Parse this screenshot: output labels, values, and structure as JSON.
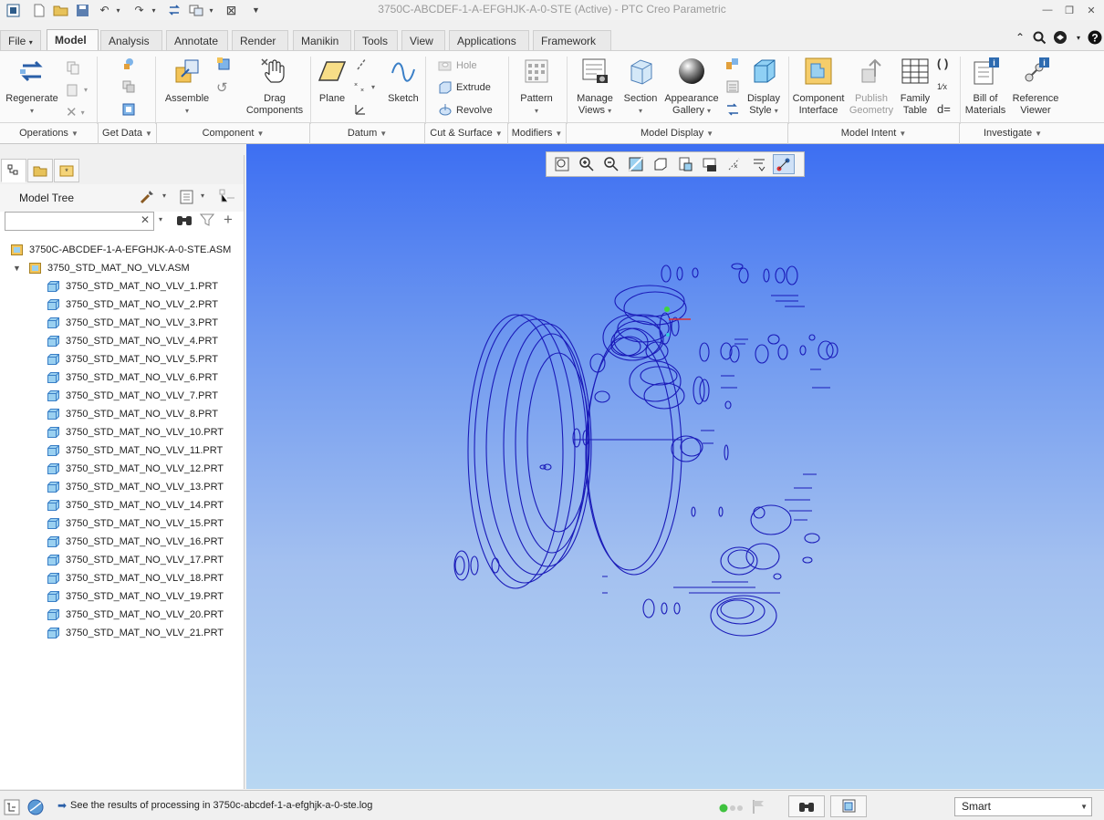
{
  "window": {
    "title": "3750C-ABCDEF-1-A-EFGHJK-A-0-STE (Active) - PTC Creo Parametric"
  },
  "tabs": [
    {
      "label": "File",
      "has_menu": true
    },
    {
      "label": "Model",
      "active": true
    },
    {
      "label": "Analysis"
    },
    {
      "label": "Annotate"
    },
    {
      "label": "Render"
    },
    {
      "label": "Manikin"
    },
    {
      "label": "Tools"
    },
    {
      "label": "View"
    },
    {
      "label": "Applications"
    },
    {
      "label": "Framework"
    }
  ],
  "ribbon": {
    "regenerate": "Regenerate",
    "assemble": "Assemble",
    "drag_line1": "Drag",
    "drag_line2": "Components",
    "plane": "Plane",
    "sketch": "Sketch",
    "hole": "Hole",
    "extrude": "Extrude",
    "revolve": "Revolve",
    "pattern": "Pattern",
    "manage_line1": "Manage",
    "manage_line2": "Views",
    "section": "Section",
    "appearance_line1": "Appearance",
    "appearance_line2": "Gallery",
    "display_line1": "Display",
    "display_line2": "Style",
    "compint_line1": "Component",
    "compint_line2": "Interface",
    "publish_line1": "Publish",
    "publish_line2": "Geometry",
    "family_line1": "Family",
    "family_line2": "Table",
    "bom_line1": "Bill of",
    "bom_line2": "Materials",
    "ref_line1": "Reference",
    "ref_line2": "Viewer"
  },
  "groups": [
    {
      "label": "Operations"
    },
    {
      "label": "Get Data"
    },
    {
      "label": "Component"
    },
    {
      "label": "Datum"
    },
    {
      "label": "Cut & Surface"
    },
    {
      "label": "Modifiers"
    },
    {
      "label": "Model Display"
    },
    {
      "label": "Model Intent"
    },
    {
      "label": "Investigate"
    }
  ],
  "model_tree": {
    "header": "Model Tree",
    "search_value": "",
    "root": "3750C-ABCDEF-1-A-EFGHJK-A-0-STE.ASM",
    "sub": "3750_STD_MAT_NO_VLV.ASM",
    "parts": [
      "3750_STD_MAT_NO_VLV_1.PRT",
      "3750_STD_MAT_NO_VLV_2.PRT",
      "3750_STD_MAT_NO_VLV_3.PRT",
      "3750_STD_MAT_NO_VLV_4.PRT",
      "3750_STD_MAT_NO_VLV_5.PRT",
      "3750_STD_MAT_NO_VLV_6.PRT",
      "3750_STD_MAT_NO_VLV_7.PRT",
      "3750_STD_MAT_NO_VLV_8.PRT",
      "3750_STD_MAT_NO_VLV_10.PRT",
      "3750_STD_MAT_NO_VLV_11.PRT",
      "3750_STD_MAT_NO_VLV_12.PRT",
      "3750_STD_MAT_NO_VLV_13.PRT",
      "3750_STD_MAT_NO_VLV_14.PRT",
      "3750_STD_MAT_NO_VLV_15.PRT",
      "3750_STD_MAT_NO_VLV_16.PRT",
      "3750_STD_MAT_NO_VLV_17.PRT",
      "3750_STD_MAT_NO_VLV_18.PRT",
      "3750_STD_MAT_NO_VLV_19.PRT",
      "3750_STD_MAT_NO_VLV_20.PRT",
      "3750_STD_MAT_NO_VLV_21.PRT"
    ]
  },
  "status": {
    "message": "See the results of processing in 3750c-abcdef-1-a-efghjk-a-0-ste.log",
    "selection_filter": "Smart"
  },
  "colors": {
    "wire": "#1a1ab8",
    "viewport_top": "#3d6ff2",
    "viewport_bottom": "#b8d7f2",
    "accent": "#2c78c8"
  }
}
